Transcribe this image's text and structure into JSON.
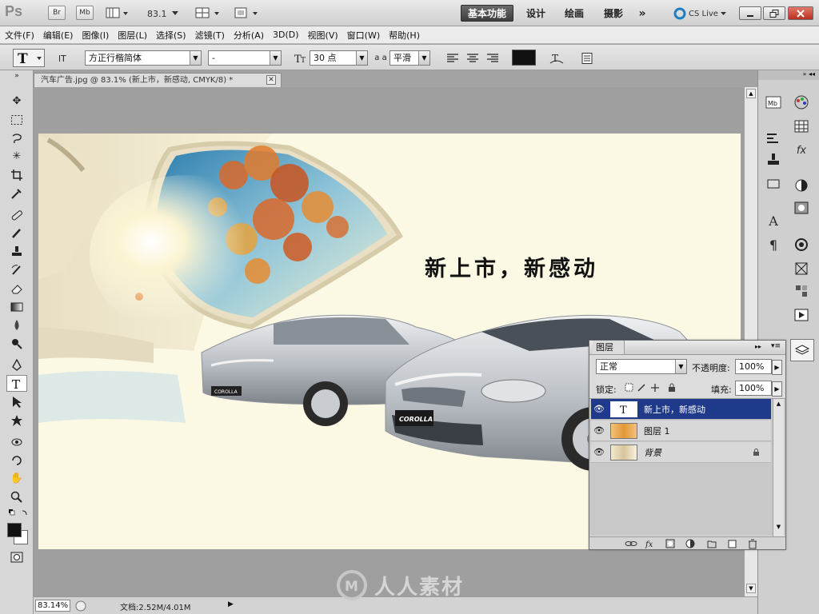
{
  "app": {
    "logo": "Ps",
    "bridge_label": "Br",
    "minibridge_label": "Mb",
    "zoom_value": "83.1",
    "workspaces": [
      "基本功能",
      "设计",
      "绘画",
      "摄影"
    ],
    "more_label": "»",
    "cslive_label": "CS Live"
  },
  "menu": [
    "文件(F)",
    "编辑(E)",
    "图像(I)",
    "图层(L)",
    "选择(S)",
    "滤镜(T)",
    "分析(A)",
    "3D(D)",
    "视图(V)",
    "窗口(W)",
    "帮助(H)"
  ],
  "options": {
    "font_family": "方正行楷简体",
    "font_style": "-",
    "font_size": "30 点",
    "antialias_label": "a a",
    "antialias": "平滑",
    "text_color": "#111111"
  },
  "document": {
    "tab_title": "汽车广告.jpg @ 83.1% (新上市，新感动, CMYK/8) *",
    "headline": "新上市，新感动",
    "car_badge_front": "COROLLA",
    "car_badge_back": "COROLLA"
  },
  "status": {
    "zoom": "83.14%",
    "doc_info": "文档:2.52M/4.01M"
  },
  "layers_panel": {
    "title": "图层",
    "blend_mode": "正常",
    "opacity_label": "不透明度:",
    "opacity_value": "100%",
    "lock_label": "锁定:",
    "fill_label": "填充:",
    "fill_value": "100%",
    "layers": [
      {
        "name": "新上市，新感动",
        "type": "text",
        "selected": true
      },
      {
        "name": "图层 1",
        "type": "image",
        "selected": false
      },
      {
        "name": "背景",
        "type": "image",
        "selected": false,
        "locked": true
      }
    ]
  },
  "watermark": "人人素材",
  "colors": {
    "selected_layer": "#1f3a8a",
    "active_workspace": "#4a4a4a",
    "close_button": "#c0392b",
    "canvas_bg": "#fbf8e4"
  }
}
